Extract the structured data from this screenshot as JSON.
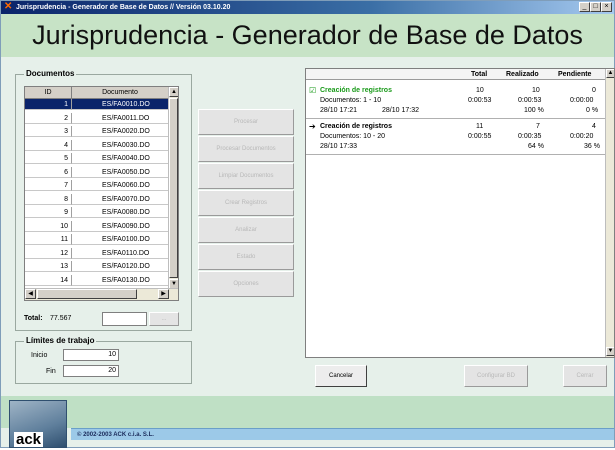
{
  "window": {
    "title": "Jurisprudencia - Generador de Base de Datos // Versión 03.10.20",
    "app_icon": "app-icon",
    "controls": [
      "_",
      "□",
      "×"
    ]
  },
  "banner": {
    "title": "Jurisprudencia - Generador de Base de Datos"
  },
  "documents": {
    "group_label": "Documentos",
    "columns": [
      "ID",
      "Documento"
    ],
    "rows": [
      {
        "id": "1",
        "doc": "ES/FA0010.DO",
        "selected": true
      },
      {
        "id": "2",
        "doc": "ES/FA0011.DO"
      },
      {
        "id": "3",
        "doc": "ES/FA0020.DO"
      },
      {
        "id": "4",
        "doc": "ES/FA0030.DO"
      },
      {
        "id": "5",
        "doc": "ES/FA0040.DO"
      },
      {
        "id": "6",
        "doc": "ES/FA0050.DO"
      },
      {
        "id": "7",
        "doc": "ES/FA0060.DO"
      },
      {
        "id": "8",
        "doc": "ES/FA0070.DO"
      },
      {
        "id": "9",
        "doc": "ES/FA0080.DO"
      },
      {
        "id": "10",
        "doc": "ES/FA0090.DO"
      },
      {
        "id": "11",
        "doc": "ES/FA0100.DO"
      },
      {
        "id": "12",
        "doc": "ES/FA0110.DO"
      },
      {
        "id": "13",
        "doc": "ES/FA0120.DO"
      },
      {
        "id": "14",
        "doc": "ES/FA0130.DO"
      }
    ],
    "total_label": "Total:",
    "total_value": "77.567",
    "total_input": "",
    "total_button": "..."
  },
  "work_limit": {
    "group_label": "Límites de trabajo",
    "start_label": "Inicio",
    "start_value": "10",
    "end_label": "Fin",
    "end_value": "20"
  },
  "actions": [
    "Procesar",
    "Procesar Documentos",
    "Limpiar Documentos",
    "Crear Registros",
    "Analizar",
    "Estado",
    "Opciones"
  ],
  "tasks": {
    "headers": [
      "Total",
      "Realizado",
      "Pendiente"
    ],
    "items": [
      {
        "done": true,
        "mark": "☑",
        "title": "Creación de registros",
        "count_total": "10",
        "count_done": "10",
        "count_pending": "0",
        "docs": "Documentos: 1 - 10",
        "time_total": "0:00:53",
        "time_done": "0:00:53",
        "time_pending": "0:00:00",
        "start": "28/10 17:21",
        "end": "28/10 17:32",
        "pct_done": "100 %",
        "pct_pending": "0 %"
      },
      {
        "done": false,
        "mark": "➔",
        "title": "Creación de registros",
        "count_total": "11",
        "count_done": "7",
        "count_pending": "4",
        "docs": "Documentos: 10 - 20",
        "time_total": "0:00:55",
        "time_done": "0:00:35",
        "time_pending": "0:00:20",
        "start": "28/10 17:33",
        "end": "",
        "pct_done": "64 %",
        "pct_pending": "36 %"
      }
    ]
  },
  "buttons": {
    "cancel": "Cancelar",
    "configure": "Configurar BD",
    "close": "Cerrar"
  },
  "footer": {
    "logo_text": "ack",
    "copyright": "© 2002-2003 ACK c.i.a. S.L."
  }
}
